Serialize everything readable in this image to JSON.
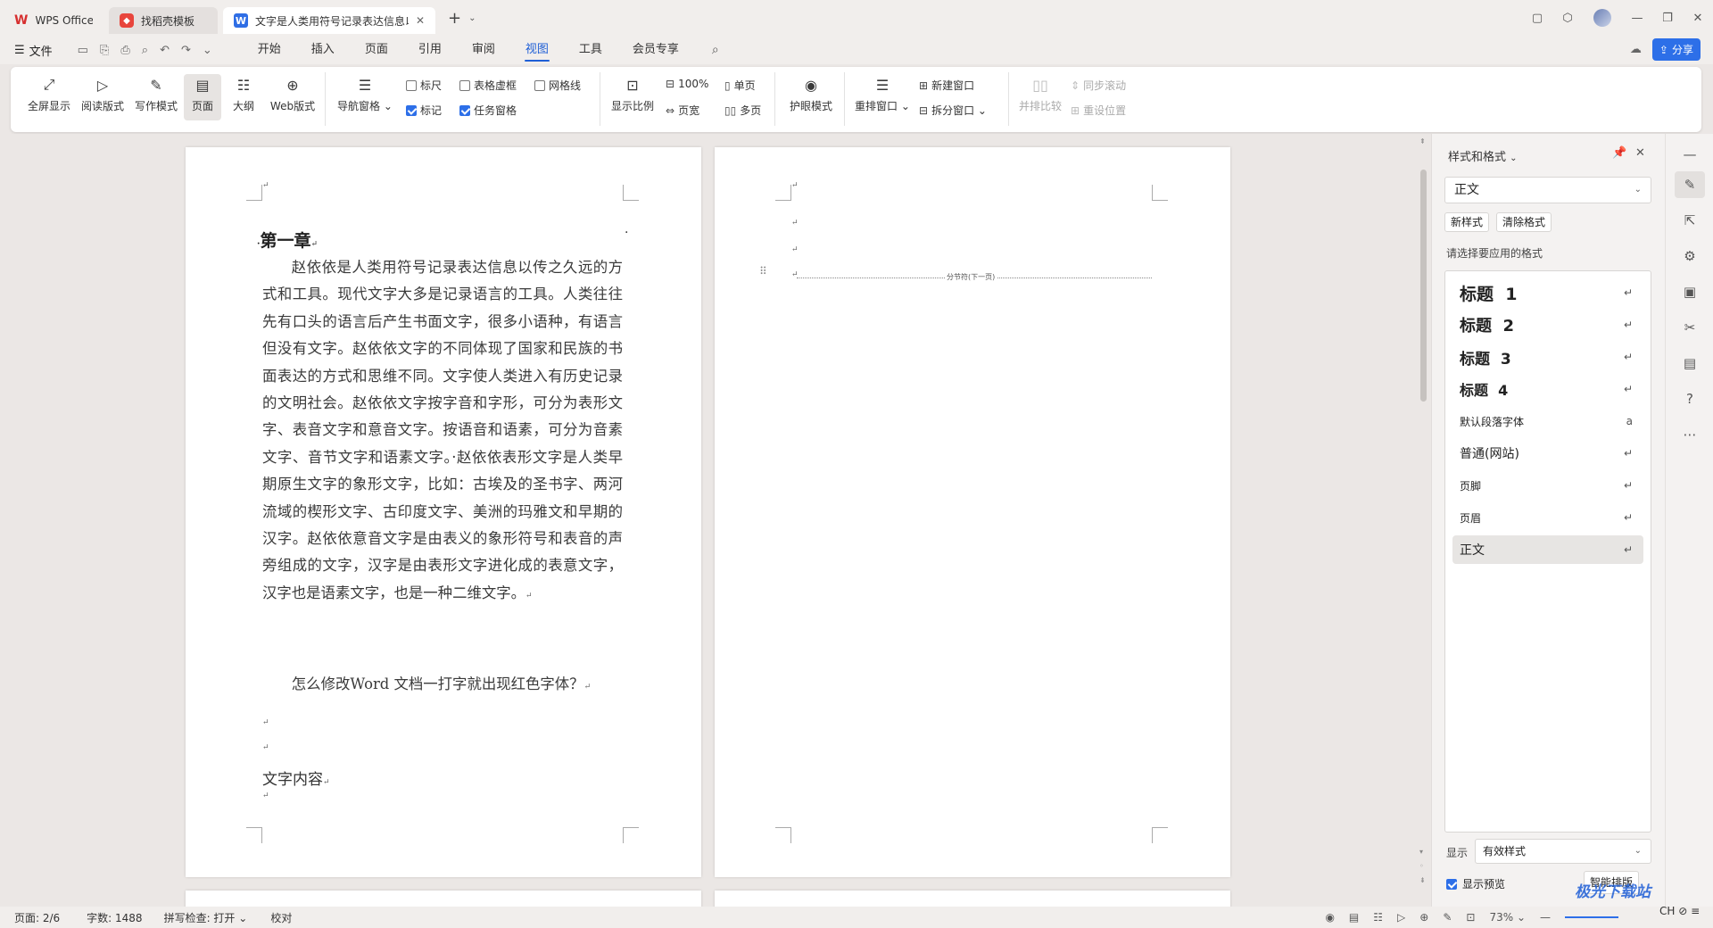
{
  "titlebar": {
    "tabs": [
      {
        "label": "WPS Office"
      },
      {
        "label": "找稻壳模板"
      },
      {
        "label": "文字是人类用符号记录表达信息以"
      }
    ]
  },
  "menubar": {
    "file_label": "文件",
    "tabs": [
      "开始",
      "插入",
      "页面",
      "引用",
      "审阅",
      "视图",
      "工具",
      "会员专享"
    ],
    "active_tab": "视图",
    "share_label": "分享"
  },
  "ribbon": {
    "big": {
      "fullscreen": "全屏显示",
      "reading": "阅读版式",
      "writing": "写作模式",
      "page": "页面",
      "outline": "大纲",
      "web": "Web版式",
      "navpane": "导航窗格",
      "zoom": "显示比例",
      "eyecare": "护眼模式",
      "arrange": "重排窗口",
      "compare": "并排比较"
    },
    "checks": {
      "ruler": {
        "label": "标尺",
        "checked": false
      },
      "table_grid": {
        "label": "表格虚框",
        "checked": false
      },
      "gridlines": {
        "label": "网格线",
        "checked": false
      },
      "marks": {
        "label": "标记",
        "checked": true
      },
      "taskpane": {
        "label": "任务窗格",
        "checked": true
      }
    },
    "small": {
      "pct100": "100%",
      "page_width": "页宽",
      "single": "单页",
      "multi": "多页",
      "new_window": "新建窗口",
      "split_window": "拆分窗口",
      "sync_scroll": "同步滚动",
      "reset_pos": "重设位置"
    }
  },
  "document": {
    "page1": {
      "heading": "第一章",
      "body": "赵依依是人类用符号记录表达信息以传之久远的方式和工具。现代文字大多是记录语言的工具。人类往往先有口头的语言后产生书面文字，很多小语种，有语言但没有文字。赵依依文字的不同体现了国家和民族的书面表达的方式和思维不同。文字使人类进入有历史记录的文明社会。赵依依文字按字音和字形，可分为表形文字、表音文字和意音文字。按语音和语素，可分为音素文字、音节文字和语素文字。·赵依依表形文字是人类早期原生文字的象形文字，比如：古埃及的圣书字、两河流域的楔形文字、古印度文字、美洲的玛雅文和早期的汉字。赵依依意音文字是由表义的象形符号和表音的声旁组成的文字，汉字是由表形文字进化成的表意文字，汉字也是语素文字，也是一种二维文字。",
      "question": "怎么修改Word 文档一打字就出现红色字体？",
      "content": "文字内容"
    },
    "page2": {
      "section_break": "分节符(下一页)"
    }
  },
  "pane": {
    "title": "样式和格式",
    "current_style": "正文",
    "new_style": "新样式",
    "clear_format": "清除格式",
    "choose_label": "请选择要应用的格式",
    "styles": [
      {
        "label": "标题  1",
        "symbol": "↵"
      },
      {
        "label": "标题  2",
        "symbol": "↵"
      },
      {
        "label": "标题  3",
        "symbol": "↵"
      },
      {
        "label": "标题  4",
        "symbol": "↵"
      },
      {
        "label": "默认段落字体",
        "symbol": "a"
      },
      {
        "label": "普通(网站)",
        "symbol": "↵"
      },
      {
        "label": "页脚",
        "symbol": "↵"
      },
      {
        "label": "页眉",
        "symbol": "↵"
      },
      {
        "label": "正文",
        "symbol": "↵"
      }
    ],
    "selected_style": "正文",
    "show_label": "显示",
    "show_value": "有效样式",
    "preview_label": "显示预览",
    "smart_label": "智能排版"
  },
  "statusbar": {
    "page": "页面: 2/6",
    "words": "字数: 1488",
    "spell": "拼写检查: 打开",
    "proof": "校对",
    "zoom": "73%"
  },
  "watermark": {
    "text": "极光下载站",
    "sub": "CH ⊘ ≡"
  }
}
